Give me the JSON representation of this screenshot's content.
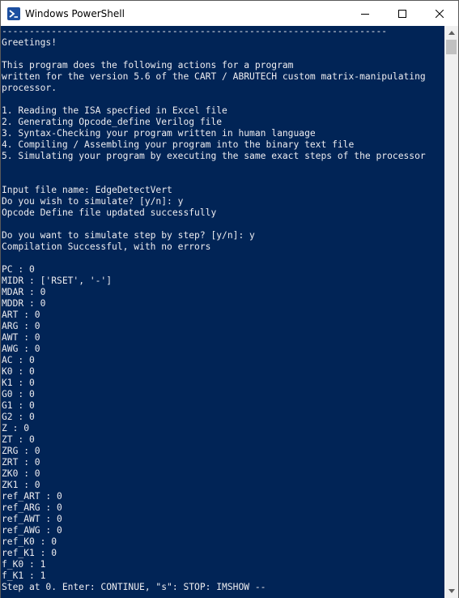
{
  "window": {
    "title": "Windows PowerShell",
    "background": "#012456",
    "text_color": "#eeedf0"
  },
  "icons": {
    "app": "powershell-icon",
    "minimize": "minimize-icon",
    "maximize": "maximize-icon",
    "close": "close-icon",
    "scroll_up": "scroll-up-arrow-icon",
    "scroll_down": "scroll-down-arrow-icon"
  },
  "console": {
    "lines": [
      "----------------------------------------------------------------------",
      "Greetings!",
      "",
      "This program does the following actions for a program",
      "written for the version 5.6 of the CART / ABRUTECH custom matrix-manipulating",
      "processor.",
      "",
      "1. Reading the ISA specfied in Excel file",
      "2. Generating Opcode_define Verilog file",
      "3. Syntax-Checking your program written in human language",
      "4. Compiling / Assembling your program into the binary text file",
      "5. Simulating your program by executing the same exact steps of the processor",
      "",
      "",
      "Input file name: EdgeDetectVert",
      "Do you wish to simulate? [y/n]: y",
      "Opcode Define file updated successfully",
      "",
      "Do you want to simulate step by step? [y/n]: y",
      "Compilation Successful, with no errors",
      "",
      "PC : 0",
      "MIDR : ['RSET', '-']",
      "MDAR : 0",
      "MDDR : 0",
      "ART : 0",
      "ARG : 0",
      "AWT : 0",
      "AWG : 0",
      "AC : 0",
      "K0 : 0",
      "K1 : 0",
      "G0 : 0",
      "G1 : 0",
      "G2 : 0",
      "Z : 0",
      "ZT : 0",
      "ZRG : 0",
      "ZRT : 0",
      "ZK0 : 0",
      "ZK1 : 0",
      "ref_ART : 0",
      "ref_ARG : 0",
      "ref_AWT : 0",
      "ref_AWG : 0",
      "ref_K0 : 0",
      "ref_K1 : 0",
      "f_K0 : 1",
      "f_K1 : 1",
      "Step at 0. Enter: CONTINUE, \"s\": STOP: IMSHOW --"
    ]
  }
}
